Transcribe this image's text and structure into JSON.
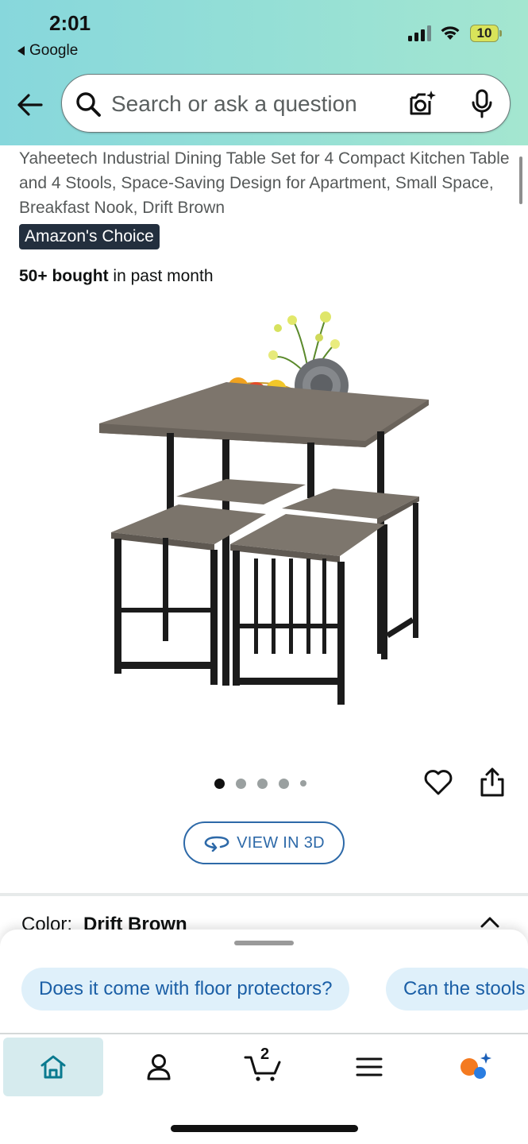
{
  "status_bar": {
    "time": "2:01",
    "back_app": "Google",
    "battery_level": "10"
  },
  "search": {
    "placeholder": "Search or ask a question"
  },
  "product": {
    "title": "Yaheetech Industrial Dining Table Set for 4 Compact Kitchen Table and 4 Stools, Space-Saving Design for Apartment, Small Space, Breakfast Nook, Drift Brown",
    "badge": "Amazon's Choice",
    "bought_strong": "50+ bought",
    "bought_rest": " in past month",
    "image_count": 5,
    "active_image_index": 0,
    "view_3d_label": "VIEW IN 3D",
    "color_label": "Color:",
    "color_value": "Drift Brown"
  },
  "suggestions": [
    {
      "label": "Does it come with floor protectors?"
    },
    {
      "label": "Can the stools"
    }
  ],
  "bottom_nav": {
    "items": [
      {
        "name": "home",
        "icon": "home-icon"
      },
      {
        "name": "account",
        "icon": "person-icon"
      },
      {
        "name": "cart",
        "icon": "cart-icon",
        "count": "2"
      },
      {
        "name": "menu",
        "icon": "menu-icon"
      },
      {
        "name": "rufus",
        "icon": "rufus-icon"
      }
    ]
  },
  "colors": {
    "header_gradient_start": "#87d7dc",
    "header_gradient_end": "#a4e6d0",
    "badge_bg": "#232f3e",
    "link_blue": "#2d69a8",
    "chip_bg": "#dff0fa",
    "home_tab_bg": "#d6ebee"
  }
}
